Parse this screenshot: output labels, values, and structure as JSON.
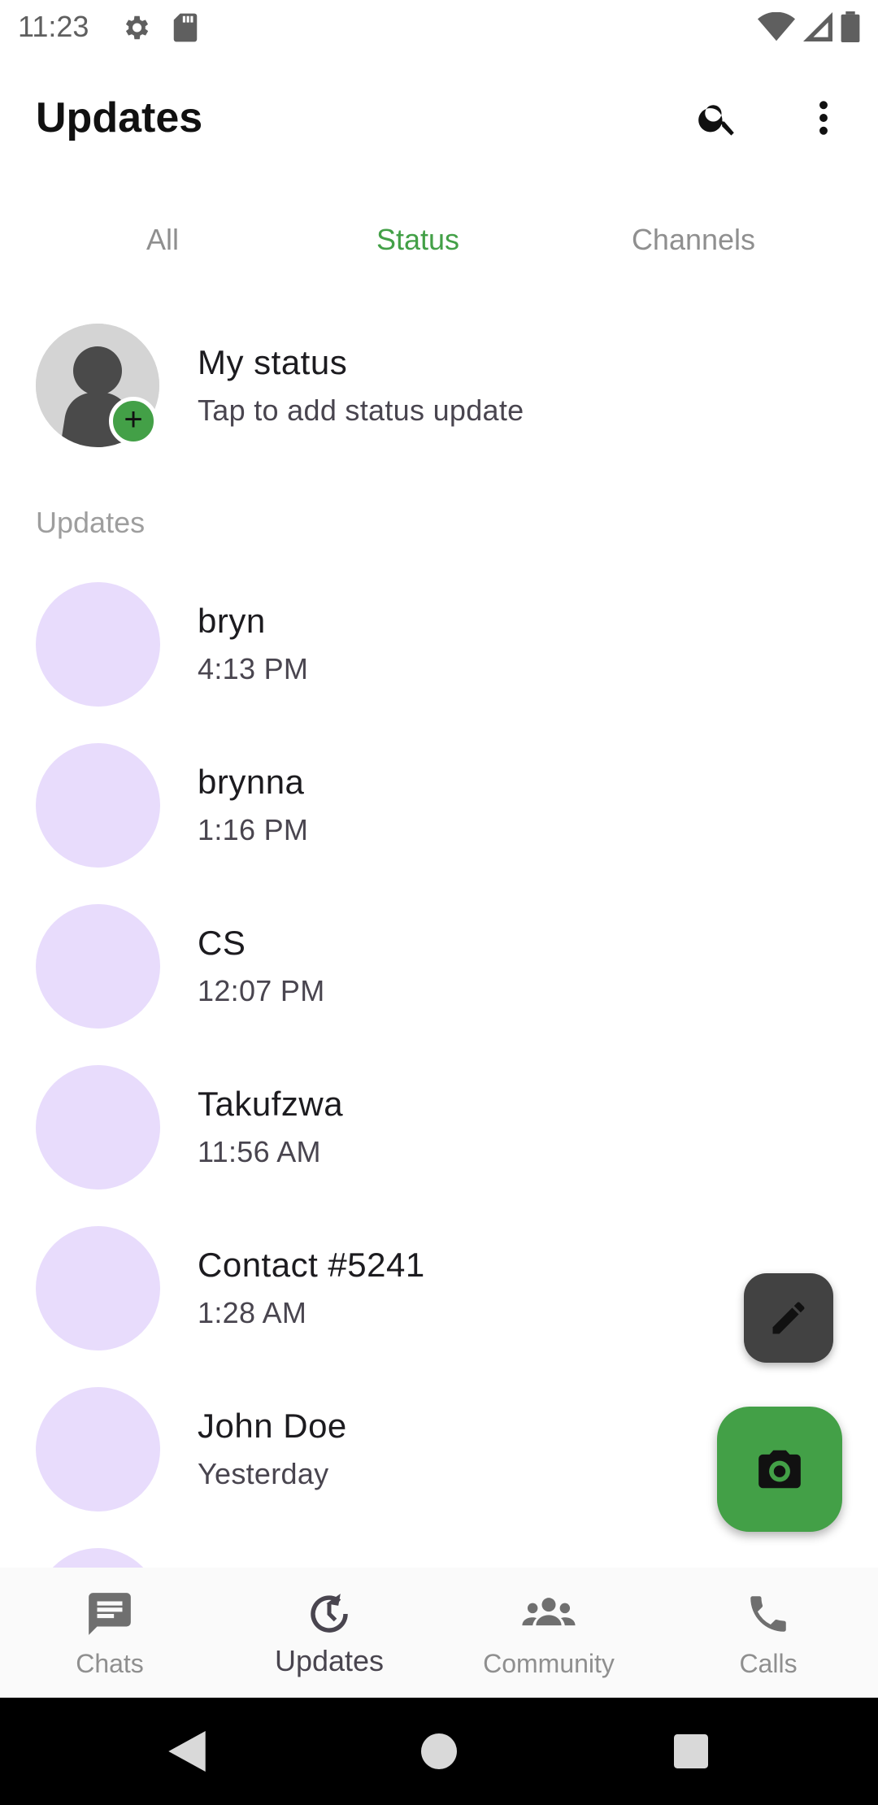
{
  "status_bar": {
    "time": "11:23"
  },
  "app_bar": {
    "title": "Updates"
  },
  "tabs": [
    {
      "label": "All",
      "active": false
    },
    {
      "label": "Status",
      "active": true
    },
    {
      "label": "Channels",
      "active": false
    }
  ],
  "my_status": {
    "name": "My status",
    "subtitle": "Tap to add status update",
    "badge": "+"
  },
  "section_label": "Updates",
  "updates": [
    {
      "name": "bryn",
      "time": "4:13 PM"
    },
    {
      "name": "brynna",
      "time": "1:16 PM"
    },
    {
      "name": "CS",
      "time": "12:07 PM"
    },
    {
      "name": "Takufzwa",
      "time": "11:56 AM"
    },
    {
      "name": "Contact #5241",
      "time": "1:28 AM"
    },
    {
      "name": "John Doe",
      "time": "Yesterday"
    }
  ],
  "bottom_nav": [
    {
      "label": "Chats",
      "icon": "chat-icon",
      "active": false
    },
    {
      "label": "Updates",
      "icon": "updates-icon",
      "active": true
    },
    {
      "label": "Community",
      "icon": "community-icon",
      "active": false
    },
    {
      "label": "Calls",
      "icon": "phone-icon",
      "active": false
    }
  ],
  "colors": {
    "accent": "#43a047",
    "avatar_placeholder": "#e8dcfc",
    "edit_fab": "#424242"
  }
}
